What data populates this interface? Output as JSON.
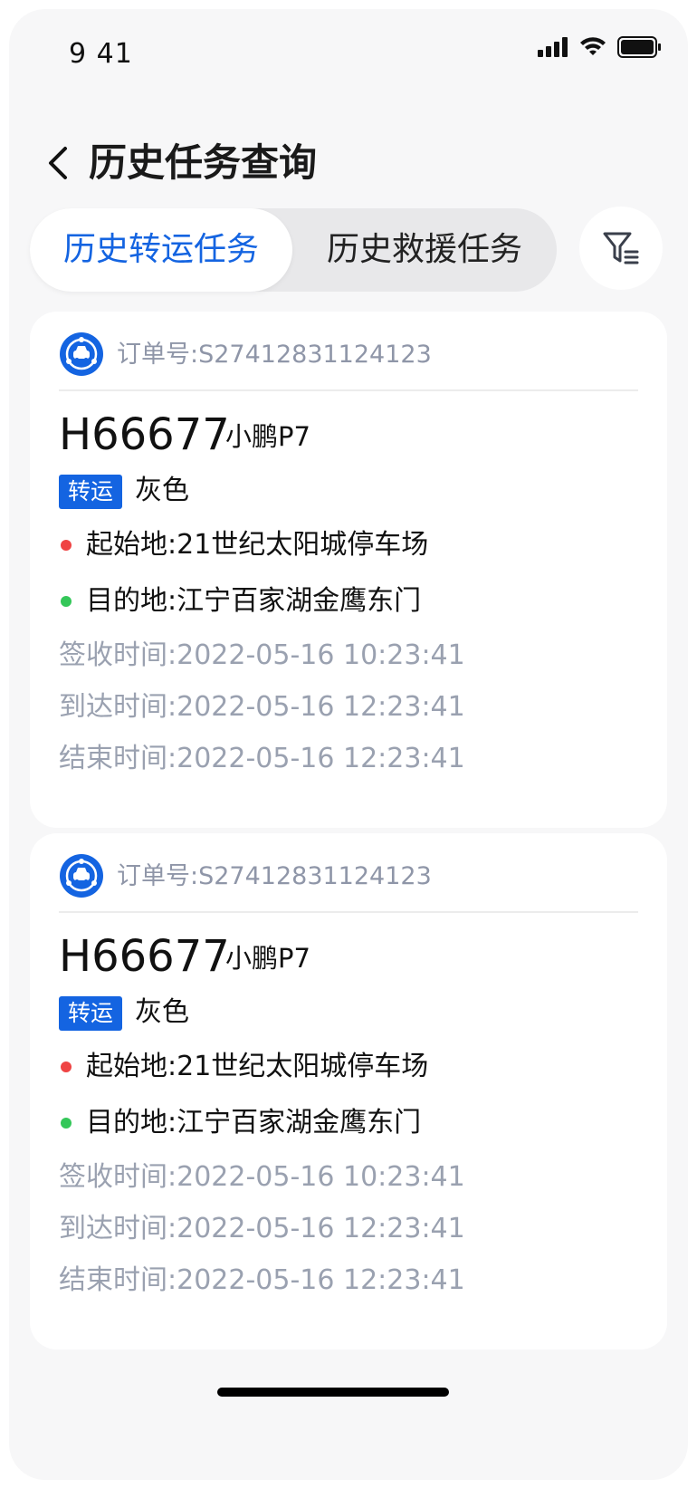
{
  "status_bar": {
    "time": "9 41"
  },
  "nav": {
    "title": "历史任务查询"
  },
  "tabs": [
    {
      "label": "历史转运任务",
      "active": true
    },
    {
      "label": "历史救援任务",
      "active": false
    }
  ],
  "colors": {
    "accent": "#1464e1",
    "origin_dot": "#ef4444",
    "dest_dot": "#34c759",
    "muted": "#9aa1b0"
  },
  "orders": [
    {
      "order_label": "订单号:",
      "order_no": "S27412831124123",
      "plate": "H66677",
      "model": "小鹏P7",
      "tag": "转运",
      "color": "灰色",
      "origin": "起始地:21世纪太阳城停车场",
      "destination": "目的地:江宁百家湖金鹰东门",
      "sign_time": "签收时间:2022-05-16 10:23:41",
      "arrive_time": "到达时间:2022-05-16 12:23:41",
      "end_time": "结束时间:2022-05-16 12:23:41"
    },
    {
      "order_label": "订单号:",
      "order_no": "S27412831124123",
      "plate": "H66677",
      "model": "小鹏P7",
      "tag": "转运",
      "color": "灰色",
      "origin": "起始地:21世纪太阳城停车场",
      "destination": "目的地:江宁百家湖金鹰东门",
      "sign_time": "签收时间:2022-05-16 10:23:41",
      "arrive_time": "到达时间:2022-05-16 12:23:41",
      "end_time": "结束时间:2022-05-16 12:23:41"
    }
  ]
}
